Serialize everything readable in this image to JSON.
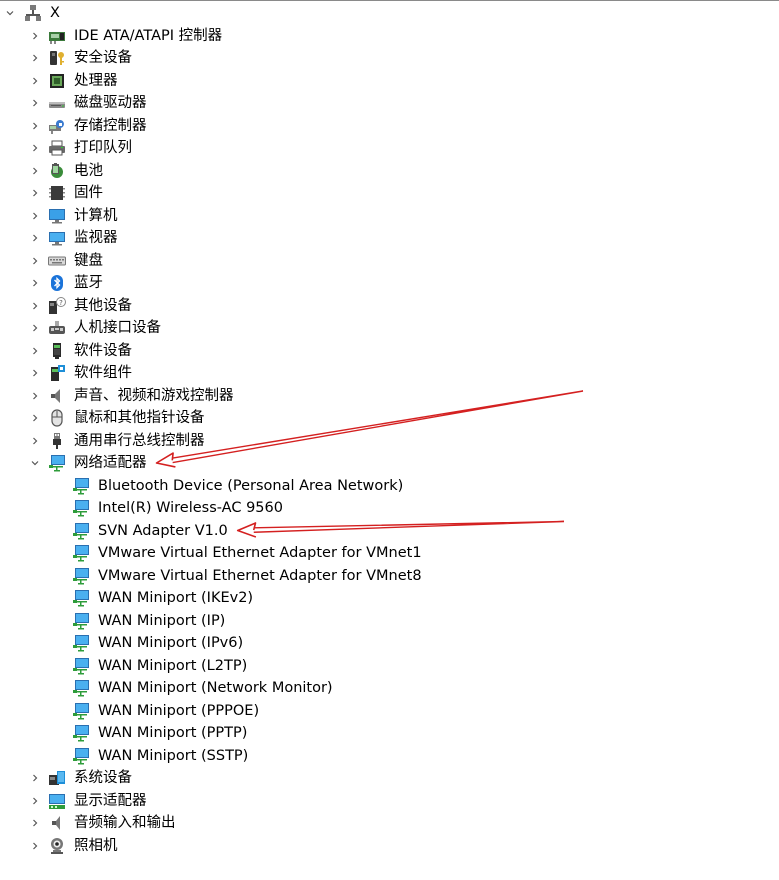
{
  "root": {
    "label": "X",
    "expanded": true,
    "icon": "computer-network-icon"
  },
  "categories": [
    {
      "label": "IDE ATA/ATAPI 控制器",
      "icon": "ide-controller-icon",
      "expanded": false
    },
    {
      "label": "安全设备",
      "icon": "security-key-icon",
      "expanded": false
    },
    {
      "label": "处理器",
      "icon": "processor-icon",
      "expanded": false
    },
    {
      "label": "磁盘驱动器",
      "icon": "disk-drive-icon",
      "expanded": false
    },
    {
      "label": "存储控制器",
      "icon": "storage-controller-icon",
      "expanded": false
    },
    {
      "label": "打印队列",
      "icon": "printer-icon",
      "expanded": false
    },
    {
      "label": "电池",
      "icon": "battery-icon",
      "expanded": false
    },
    {
      "label": "固件",
      "icon": "firmware-icon",
      "expanded": false
    },
    {
      "label": "计算机",
      "icon": "computer-icon",
      "expanded": false
    },
    {
      "label": "监视器",
      "icon": "monitor-icon",
      "expanded": false
    },
    {
      "label": "键盘",
      "icon": "keyboard-icon",
      "expanded": false
    },
    {
      "label": "蓝牙",
      "icon": "bluetooth-icon",
      "expanded": false
    },
    {
      "label": "其他设备",
      "icon": "unknown-device-icon",
      "expanded": false
    },
    {
      "label": "人机接口设备",
      "icon": "hid-icon",
      "expanded": false
    },
    {
      "label": "软件设备",
      "icon": "software-device-icon",
      "expanded": false
    },
    {
      "label": "软件组件",
      "icon": "software-component-icon",
      "expanded": false
    },
    {
      "label": "声音、视频和游戏控制器",
      "icon": "speaker-icon",
      "expanded": false
    },
    {
      "label": "鼠标和其他指针设备",
      "icon": "mouse-icon",
      "expanded": false
    },
    {
      "label": "通用串行总线控制器",
      "icon": "usb-icon",
      "expanded": false
    },
    {
      "label": "网络适配器",
      "icon": "network-adapter-icon",
      "expanded": true,
      "children": [
        {
          "label": "Bluetooth Device (Personal Area Network)",
          "icon": "network-adapter-icon"
        },
        {
          "label": "Intel(R) Wireless-AC 9560",
          "icon": "network-adapter-icon"
        },
        {
          "label": "SVN Adapter V1.0",
          "icon": "network-adapter-icon"
        },
        {
          "label": "VMware Virtual Ethernet Adapter for VMnet1",
          "icon": "network-adapter-icon"
        },
        {
          "label": "VMware Virtual Ethernet Adapter for VMnet8",
          "icon": "network-adapter-icon"
        },
        {
          "label": "WAN Miniport (IKEv2)",
          "icon": "network-adapter-icon"
        },
        {
          "label": "WAN Miniport (IP)",
          "icon": "network-adapter-icon"
        },
        {
          "label": "WAN Miniport (IPv6)",
          "icon": "network-adapter-icon"
        },
        {
          "label": "WAN Miniport (L2TP)",
          "icon": "network-adapter-icon"
        },
        {
          "label": "WAN Miniport (Network Monitor)",
          "icon": "network-adapter-icon"
        },
        {
          "label": "WAN Miniport (PPPOE)",
          "icon": "network-adapter-icon"
        },
        {
          "label": "WAN Miniport (PPTP)",
          "icon": "network-adapter-icon"
        },
        {
          "label": "WAN Miniport (SSTP)",
          "icon": "network-adapter-icon"
        }
      ]
    },
    {
      "label": "系统设备",
      "icon": "system-device-icon",
      "expanded": false
    },
    {
      "label": "显示适配器",
      "icon": "display-adapter-icon",
      "expanded": false
    },
    {
      "label": "音频输入和输出",
      "icon": "audio-io-icon",
      "expanded": false
    },
    {
      "label": "照相机",
      "icon": "camera-icon",
      "expanded": false
    }
  ],
  "annotations": {
    "arrow_color": "#d42020",
    "arrow_targets": [
      "网络适配器",
      "SVN Adapter V1.0"
    ]
  },
  "colors": {
    "chevron": "#555555",
    "monitor_blue": "#1e8fd8",
    "monitor_frame": "#2a6fb0"
  }
}
